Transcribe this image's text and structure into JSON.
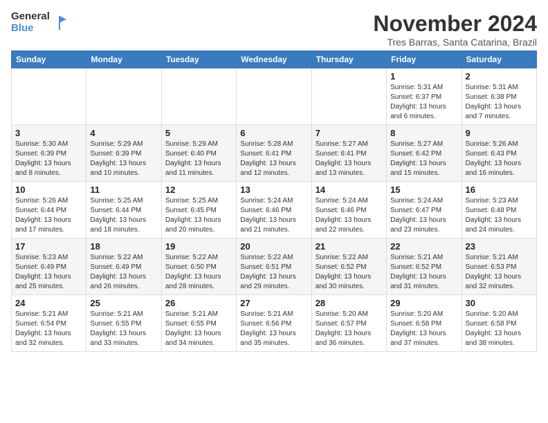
{
  "logo": {
    "line1": "General",
    "line2": "Blue"
  },
  "title": "November 2024",
  "subtitle": "Tres Barras, Santa Catarina, Brazil",
  "days_header": [
    "Sunday",
    "Monday",
    "Tuesday",
    "Wednesday",
    "Thursday",
    "Friday",
    "Saturday"
  ],
  "weeks": [
    [
      {
        "day": "",
        "info": ""
      },
      {
        "day": "",
        "info": ""
      },
      {
        "day": "",
        "info": ""
      },
      {
        "day": "",
        "info": ""
      },
      {
        "day": "",
        "info": ""
      },
      {
        "day": "1",
        "info": "Sunrise: 5:31 AM\nSunset: 6:37 PM\nDaylight: 13 hours and 6 minutes."
      },
      {
        "day": "2",
        "info": "Sunrise: 5:31 AM\nSunset: 6:38 PM\nDaylight: 13 hours and 7 minutes."
      }
    ],
    [
      {
        "day": "3",
        "info": "Sunrise: 5:30 AM\nSunset: 6:39 PM\nDaylight: 13 hours and 8 minutes."
      },
      {
        "day": "4",
        "info": "Sunrise: 5:29 AM\nSunset: 6:39 PM\nDaylight: 13 hours and 10 minutes."
      },
      {
        "day": "5",
        "info": "Sunrise: 5:29 AM\nSunset: 6:40 PM\nDaylight: 13 hours and 11 minutes."
      },
      {
        "day": "6",
        "info": "Sunrise: 5:28 AM\nSunset: 6:41 PM\nDaylight: 13 hours and 12 minutes."
      },
      {
        "day": "7",
        "info": "Sunrise: 5:27 AM\nSunset: 6:41 PM\nDaylight: 13 hours and 13 minutes."
      },
      {
        "day": "8",
        "info": "Sunrise: 5:27 AM\nSunset: 6:42 PM\nDaylight: 13 hours and 15 minutes."
      },
      {
        "day": "9",
        "info": "Sunrise: 5:26 AM\nSunset: 6:43 PM\nDaylight: 13 hours and 16 minutes."
      }
    ],
    [
      {
        "day": "10",
        "info": "Sunrise: 5:26 AM\nSunset: 6:44 PM\nDaylight: 13 hours and 17 minutes."
      },
      {
        "day": "11",
        "info": "Sunrise: 5:25 AM\nSunset: 6:44 PM\nDaylight: 13 hours and 18 minutes."
      },
      {
        "day": "12",
        "info": "Sunrise: 5:25 AM\nSunset: 6:45 PM\nDaylight: 13 hours and 20 minutes."
      },
      {
        "day": "13",
        "info": "Sunrise: 5:24 AM\nSunset: 6:46 PM\nDaylight: 13 hours and 21 minutes."
      },
      {
        "day": "14",
        "info": "Sunrise: 5:24 AM\nSunset: 6:46 PM\nDaylight: 13 hours and 22 minutes."
      },
      {
        "day": "15",
        "info": "Sunrise: 5:24 AM\nSunset: 6:47 PM\nDaylight: 13 hours and 23 minutes."
      },
      {
        "day": "16",
        "info": "Sunrise: 5:23 AM\nSunset: 6:48 PM\nDaylight: 13 hours and 24 minutes."
      }
    ],
    [
      {
        "day": "17",
        "info": "Sunrise: 5:23 AM\nSunset: 6:49 PM\nDaylight: 13 hours and 25 minutes."
      },
      {
        "day": "18",
        "info": "Sunrise: 5:22 AM\nSunset: 6:49 PM\nDaylight: 13 hours and 26 minutes."
      },
      {
        "day": "19",
        "info": "Sunrise: 5:22 AM\nSunset: 6:50 PM\nDaylight: 13 hours and 28 minutes."
      },
      {
        "day": "20",
        "info": "Sunrise: 5:22 AM\nSunset: 6:51 PM\nDaylight: 13 hours and 29 minutes."
      },
      {
        "day": "21",
        "info": "Sunrise: 5:22 AM\nSunset: 6:52 PM\nDaylight: 13 hours and 30 minutes."
      },
      {
        "day": "22",
        "info": "Sunrise: 5:21 AM\nSunset: 6:52 PM\nDaylight: 13 hours and 31 minutes."
      },
      {
        "day": "23",
        "info": "Sunrise: 5:21 AM\nSunset: 6:53 PM\nDaylight: 13 hours and 32 minutes."
      }
    ],
    [
      {
        "day": "24",
        "info": "Sunrise: 5:21 AM\nSunset: 6:54 PM\nDaylight: 13 hours and 32 minutes."
      },
      {
        "day": "25",
        "info": "Sunrise: 5:21 AM\nSunset: 6:55 PM\nDaylight: 13 hours and 33 minutes."
      },
      {
        "day": "26",
        "info": "Sunrise: 5:21 AM\nSunset: 6:55 PM\nDaylight: 13 hours and 34 minutes."
      },
      {
        "day": "27",
        "info": "Sunrise: 5:21 AM\nSunset: 6:56 PM\nDaylight: 13 hours and 35 minutes."
      },
      {
        "day": "28",
        "info": "Sunrise: 5:20 AM\nSunset: 6:57 PM\nDaylight: 13 hours and 36 minutes."
      },
      {
        "day": "29",
        "info": "Sunrise: 5:20 AM\nSunset: 6:58 PM\nDaylight: 13 hours and 37 minutes."
      },
      {
        "day": "30",
        "info": "Sunrise: 5:20 AM\nSunset: 6:58 PM\nDaylight: 13 hours and 38 minutes."
      }
    ]
  ]
}
